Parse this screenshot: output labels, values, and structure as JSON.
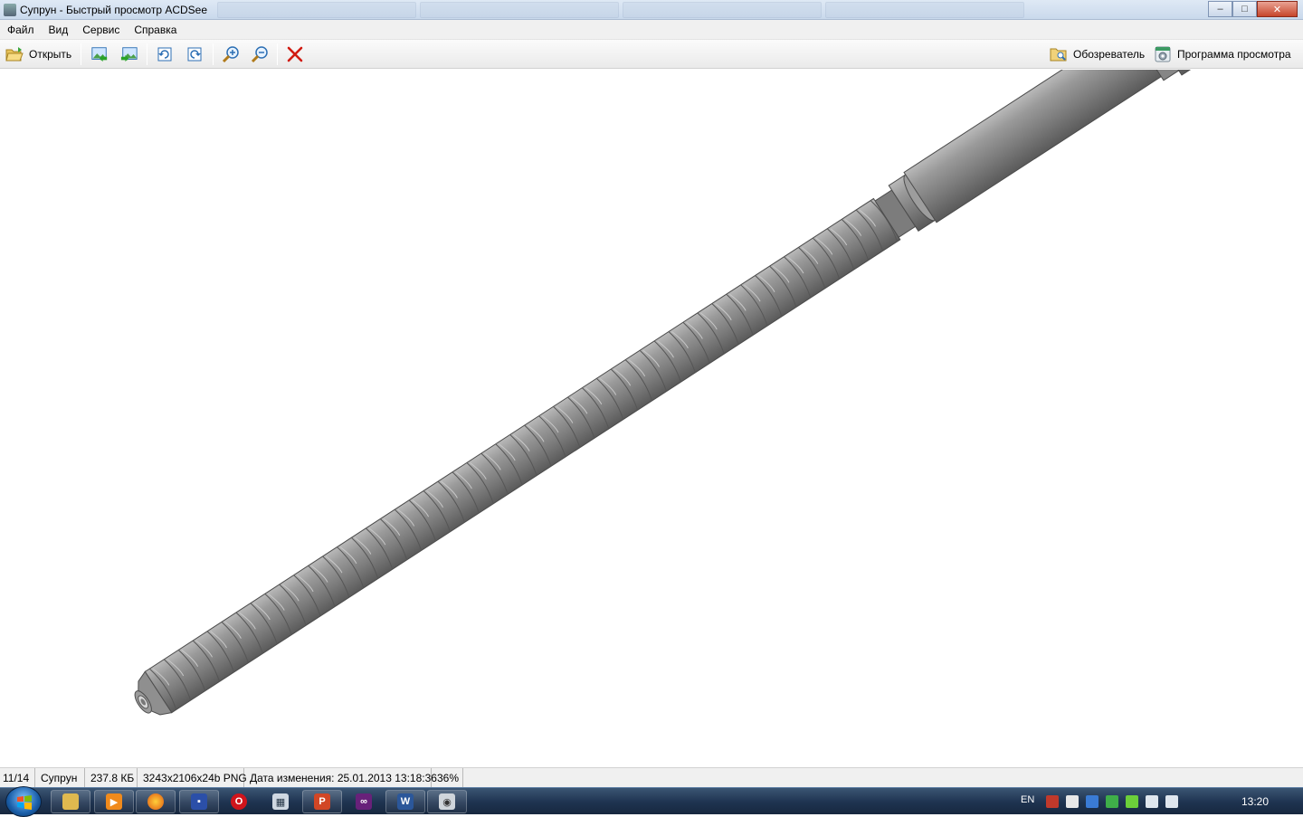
{
  "window": {
    "title": "Супрун - Быстрый просмотр ACDSee",
    "controls": {
      "minimize": "–",
      "maximize": "□",
      "close": "✕"
    }
  },
  "menu": {
    "items": [
      "Файл",
      "Вид",
      "Сервис",
      "Справка"
    ]
  },
  "toolbar": {
    "open_label": "Открыть",
    "browser_label": "Обозреватель",
    "viewer_label": "Программа просмотра"
  },
  "status": {
    "position": "11/14",
    "name": "Супрун",
    "size": "237.8 КБ",
    "dimensions": "3243x2106x24b PNG",
    "modified": "Дата изменения: 25.01.2013 13:18:36",
    "zoom": "36%"
  },
  "taskbar": {
    "language": "EN",
    "time": "13:20",
    "icons": [
      "explorer-icon",
      "media-player-icon",
      "firefox-icon",
      "save-icon",
      "opera-icon",
      "calculator-icon",
      "powerpoint-icon",
      "visual-studio-icon",
      "word-icon",
      "acdsee-icon"
    ]
  },
  "colors": {
    "part_dark": "#6a6a6a",
    "part_mid": "#8f8f8f",
    "part_light": "#b6b6b6",
    "close_red": "#c7452b",
    "delete_red": "#d11a10"
  }
}
